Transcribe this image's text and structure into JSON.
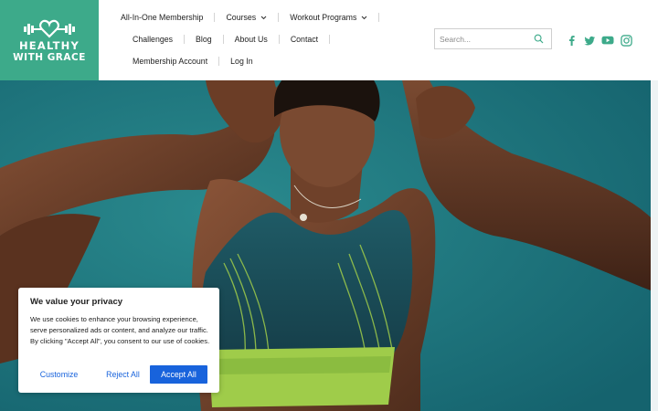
{
  "brand": {
    "line1": "HEALTHY",
    "line2": "WITH GRACE",
    "color": "#3daa8a"
  },
  "nav": {
    "row1": [
      {
        "label": "All-In-One Membership",
        "dropdown": false
      },
      {
        "label": "Courses",
        "dropdown": true
      },
      {
        "label": "Workout Programs",
        "dropdown": true
      }
    ],
    "row2": [
      {
        "label": "Challenges"
      },
      {
        "label": "Blog"
      },
      {
        "label": "About Us"
      },
      {
        "label": "Contact"
      }
    ],
    "row3": [
      {
        "label": "Membership Account"
      },
      {
        "label": "Log In"
      }
    ]
  },
  "search": {
    "placeholder": "Search...",
    "value": ""
  },
  "social": {
    "icons": [
      "facebook-icon",
      "twitter-icon",
      "youtube-icon",
      "instagram-icon"
    ],
    "color": "#3daa8a"
  },
  "hero": {
    "image": "woman-in-sports-bra-hero-photo",
    "background": "#1a6e78"
  },
  "cookie_banner": {
    "title": "We value your privacy",
    "body": "We use cookies to enhance your browsing experience, serve personalized ads or content, and analyze our traffic. By clicking \"Accept All\", you consent to our use of cookies.",
    "customize_label": "Customize",
    "reject_label": "Reject All",
    "accept_label": "Accept All",
    "accent": "#1863dc"
  }
}
